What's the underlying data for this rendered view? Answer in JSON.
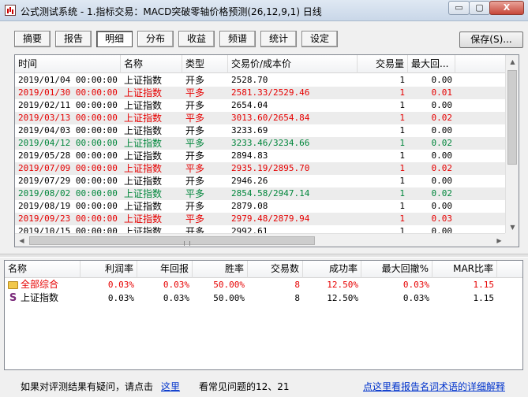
{
  "window": {
    "title": "公式测试系统 - 1.指标交易：MACD突破零轴价格预测(26,12,9,1) 日线",
    "min_label": "▭",
    "max_label": "▢",
    "close_label": "X"
  },
  "tabs": [
    {
      "label": "摘要"
    },
    {
      "label": "报告"
    },
    {
      "label": "明细"
    },
    {
      "label": "分布"
    },
    {
      "label": "收益"
    },
    {
      "label": "频谱"
    },
    {
      "label": "统计"
    },
    {
      "label": "设定"
    }
  ],
  "save_label": "保存(S)...",
  "trades": {
    "columns": [
      "时间",
      "名称",
      "类型",
      "交易价/成本价",
      "交易量",
      "最大回..."
    ],
    "rows": [
      {
        "time": "2019/01/04 00:00:00",
        "name": "上证指数",
        "type": "开多",
        "price": "2528.70",
        "qty": "1",
        "dd": "0.00",
        "color": "black"
      },
      {
        "time": "2019/01/30 00:00:00",
        "name": "上证指数",
        "type": "平多",
        "price": "2581.33/2529.46",
        "qty": "1",
        "dd": "0.01",
        "color": "red"
      },
      {
        "time": "2019/02/11 00:00:00",
        "name": "上证指数",
        "type": "开多",
        "price": "2654.04",
        "qty": "1",
        "dd": "0.00",
        "color": "black"
      },
      {
        "time": "2019/03/13 00:00:00",
        "name": "上证指数",
        "type": "平多",
        "price": "3013.60/2654.84",
        "qty": "1",
        "dd": "0.02",
        "color": "red"
      },
      {
        "time": "2019/04/03 00:00:00",
        "name": "上证指数",
        "type": "开多",
        "price": "3233.69",
        "qty": "1",
        "dd": "0.00",
        "color": "black"
      },
      {
        "time": "2019/04/12 00:00:00",
        "name": "上证指数",
        "type": "平多",
        "price": "3233.46/3234.66",
        "qty": "1",
        "dd": "0.02",
        "color": "green"
      },
      {
        "time": "2019/05/28 00:00:00",
        "name": "上证指数",
        "type": "开多",
        "price": "2894.83",
        "qty": "1",
        "dd": "0.00",
        "color": "black"
      },
      {
        "time": "2019/07/09 00:00:00",
        "name": "上证指数",
        "type": "平多",
        "price": "2935.19/2895.70",
        "qty": "1",
        "dd": "0.02",
        "color": "red"
      },
      {
        "time": "2019/07/29 00:00:00",
        "name": "上证指数",
        "type": "开多",
        "price": "2946.26",
        "qty": "1",
        "dd": "0.00",
        "color": "black"
      },
      {
        "time": "2019/08/02 00:00:00",
        "name": "上证指数",
        "type": "平多",
        "price": "2854.58/2947.14",
        "qty": "1",
        "dd": "0.02",
        "color": "green"
      },
      {
        "time": "2019/08/19 00:00:00",
        "name": "上证指数",
        "type": "开多",
        "price": "2879.08",
        "qty": "1",
        "dd": "0.00",
        "color": "black"
      },
      {
        "time": "2019/09/23 00:00:00",
        "name": "上证指数",
        "type": "平多",
        "price": "2979.48/2879.94",
        "qty": "1",
        "dd": "0.03",
        "color": "red"
      },
      {
        "time": "2019/10/15 00:00:00",
        "name": "上证指数",
        "type": "开多",
        "price": "2992.61",
        "qty": "1",
        "dd": "0.00",
        "color": "black"
      }
    ]
  },
  "summary": {
    "columns": [
      "名称",
      "利润率",
      "年回报",
      "胜率",
      "交易数",
      "成功率",
      "最大回撤%",
      "MAR比率"
    ],
    "rows": [
      {
        "icon": "folder",
        "name": "全部综合",
        "profit": "0.03%",
        "annual": "0.03%",
        "win": "50.00%",
        "count": "8",
        "success": "12.50%",
        "maxdd": "0.03%",
        "mar": "1.15",
        "color": "red"
      },
      {
        "icon": "s",
        "name": "上证指数",
        "profit": "0.03%",
        "annual": "0.03%",
        "win": "50.00%",
        "count": "8",
        "success": "12.50%",
        "maxdd": "0.03%",
        "mar": "1.15",
        "color": "black"
      }
    ]
  },
  "status": {
    "question_text": "如果对评测结果有疑问，请点击",
    "here_link": "这里",
    "faq_text": "看常见问题的12、21",
    "glossary_link": "点这里看报告名词术语的详细解释"
  }
}
